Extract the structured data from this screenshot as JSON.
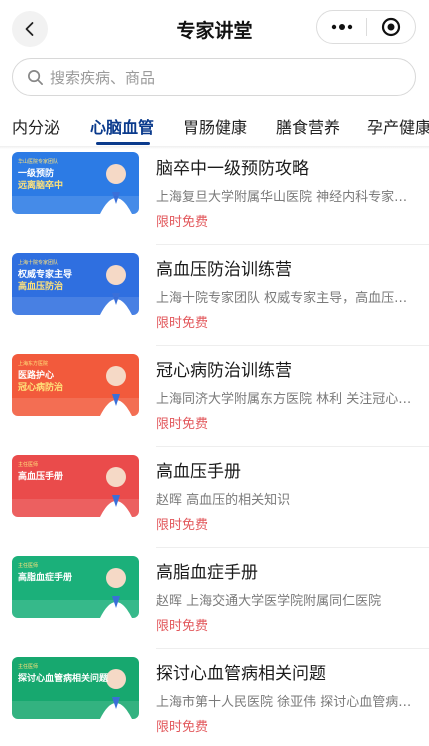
{
  "header": {
    "title": "专家讲堂",
    "back_icon": "chevron-left-icon",
    "more_icon": "more-dots-icon",
    "close_icon": "target-circle-icon"
  },
  "search": {
    "placeholder": "搜索疾病、商品",
    "icon": "search-icon"
  },
  "tabs": [
    {
      "label": "内分泌",
      "active": false
    },
    {
      "label": "心脑血管",
      "active": true
    },
    {
      "label": "胃肠健康",
      "active": false
    },
    {
      "label": "膳食营养",
      "active": false
    },
    {
      "label": "孕产健康",
      "active": false
    }
  ],
  "accent": "#0a3a8c",
  "price_color": "#e2585c",
  "courses": [
    {
      "title": "脑卒中一级预防攻略",
      "desc": "上海复旦大学附属华山医院 神经内科专家…",
      "price": "限时免费",
      "thumb": {
        "bg": "#2c7be5",
        "line1": "一级预防",
        "line2": "远离脑卒中",
        "tag": "华山医院专家团队"
      }
    },
    {
      "title": "高血压防治训练营",
      "desc": "上海十院专家团队 权威专家主导，高血压…",
      "price": "限时免费",
      "thumb": {
        "bg": "#2f6fe0",
        "line1": "权威专家主导",
        "line2": "高血压防治",
        "tag": "上海十院专家团队"
      }
    },
    {
      "title": "冠心病防治训练营",
      "desc": "上海同济大学附属东方医院 林利 关注冠心…",
      "price": "限时免费",
      "thumb": {
        "bg": "#f25a3c",
        "line1": "医路护心",
        "line2": "冠心病防治",
        "tag": "上海东方医院"
      }
    },
    {
      "title": "高血压手册",
      "desc": "赵晖 高血压的相关知识",
      "price": "限时免费",
      "thumb": {
        "bg": "#ea4b4b",
        "line1": "高血压手册",
        "line2": "",
        "tag": "主任医师"
      }
    },
    {
      "title": "高脂血症手册",
      "desc": "赵晖 上海交通大学医学院附属同仁医院",
      "price": "限时免费",
      "thumb": {
        "bg": "#1bb07a",
        "line1": "高脂血症手册",
        "line2": "",
        "tag": "主任医师"
      }
    },
    {
      "title": "探讨心血管病相关问题",
      "desc": "上海市第十人民医院 徐亚伟 探讨心血管病…",
      "price": "限时免费",
      "thumb": {
        "bg": "#17a86f",
        "line1": "探讨心血管病相关问题",
        "line2": "",
        "tag": "主任医师"
      }
    }
  ]
}
